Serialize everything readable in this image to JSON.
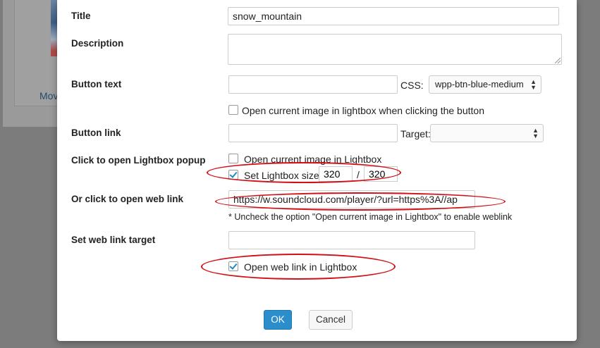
{
  "background": {
    "link_text": "Mov"
  },
  "form": {
    "title_label": "Title",
    "title_value": "snow_mountain",
    "description_label": "Description",
    "description_value": "",
    "button_text_label": "Button text",
    "button_text_value": "",
    "css_label": "CSS:",
    "css_value": "wpp-btn-blue-medium",
    "open_lightbox_on_button_label": "Open current image in lightbox when clicking the button",
    "open_lightbox_on_button_checked": false,
    "button_link_label": "Button link",
    "button_link_value": "",
    "target_label": "Target:",
    "target_value": "",
    "lightbox_popup_label": "Click to open Lightbox popup",
    "open_current_in_lightbox_label": "Open current image in Lightbox",
    "open_current_in_lightbox_checked": false,
    "set_lightbox_size_label": "Set Lightbox size",
    "set_lightbox_size_checked": true,
    "lightbox_width": "320",
    "size_separator": "/",
    "lightbox_height": "320",
    "web_link_label": "Or click to open web link",
    "web_link_value": "https://w.soundcloud.com/player/?url=https%3A//ap",
    "web_link_note": "* Uncheck the option \"Open current image in Lightbox\" to enable weblink",
    "web_link_target_label": "Set web link target",
    "web_link_target_value": "",
    "open_web_link_in_lightbox_label": "Open web link in Lightbox",
    "open_web_link_in_lightbox_checked": true
  },
  "buttons": {
    "ok": "OK",
    "cancel": "Cancel"
  },
  "colors": {
    "accent": "#2c8dcb",
    "annotation": "#d10f16",
    "check": "#1e8cbe"
  }
}
